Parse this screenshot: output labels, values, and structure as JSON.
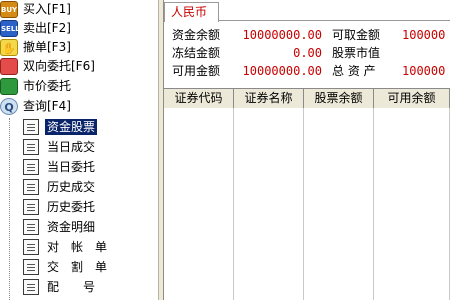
{
  "tree": {
    "top_items": [
      {
        "label": "买入[F1]",
        "icon": "buy-icon",
        "icon_text": "BUY"
      },
      {
        "label": "卖出[F2]",
        "icon": "sell-icon",
        "icon_text": "SELL"
      },
      {
        "label": "撤单[F3]",
        "icon": "cancel-icon",
        "icon_text": "✋"
      },
      {
        "label": "双向委托[F6]",
        "icon": "dual-order-icon",
        "icon_text": ""
      },
      {
        "label": "市价委托",
        "icon": "market-order-icon",
        "icon_text": ""
      },
      {
        "label": "查询[F4]",
        "icon": "query-icon",
        "icon_text": "Q"
      }
    ],
    "query_children": [
      {
        "label": "资金股票",
        "selected": true
      },
      {
        "label": "当日成交"
      },
      {
        "label": "当日委托"
      },
      {
        "label": "历史成交"
      },
      {
        "label": "历史委托"
      },
      {
        "label": "资金明细"
      },
      {
        "label": "对　帐　单"
      },
      {
        "label": "交　割　单"
      },
      {
        "label": "配　　号"
      }
    ]
  },
  "panel": {
    "tab_label": "人民币",
    "fields": {
      "fund_balance_label": "资金余额",
      "fund_balance_value": "10000000.00",
      "withdrawable_label": "可取金额",
      "withdrawable_value": "100000",
      "frozen_label": "冻结金额",
      "frozen_value": "0.00",
      "stock_value_label": "股票市值",
      "available_label": "可用金额",
      "available_value": "10000000.00",
      "total_assets_label": "总 资 产",
      "total_assets_value": "100000"
    },
    "columns": [
      "证券代码",
      "证券名称",
      "股票余额",
      "可用余额"
    ]
  },
  "colors": {
    "value_red": "#c80000",
    "selection": "#0a246a",
    "header_bg": "#ece9d8"
  }
}
